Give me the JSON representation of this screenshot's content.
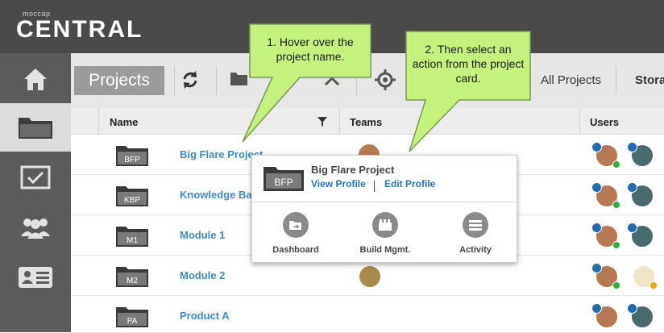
{
  "app": {
    "logo_small": "moccap",
    "logo_big": "CENTRAL"
  },
  "sidebar": {
    "items": [
      {
        "name": "home"
      },
      {
        "name": "projects"
      },
      {
        "name": "tasks"
      },
      {
        "name": "teams"
      },
      {
        "name": "users"
      }
    ]
  },
  "toolbar": {
    "projects_tab": "Projects",
    "filter_label": "All Projects",
    "storage_label": "Stora"
  },
  "table": {
    "headers": {
      "name": "Name",
      "teams": "Teams",
      "users": "Users"
    },
    "rows": [
      {
        "code": "BFP",
        "name": "Big Flare Project"
      },
      {
        "code": "KBP",
        "name": "Knowledge Ba"
      },
      {
        "code": "M1",
        "name": "Module 1"
      },
      {
        "code": "M2",
        "name": "Module 2"
      },
      {
        "code": "PA",
        "name": "Product A"
      }
    ]
  },
  "card": {
    "code": "BFP",
    "title": "Big Flare Project",
    "view_profile": "View Profile",
    "edit_profile": "Edit Profile",
    "actions": [
      {
        "label": "Dashboard",
        "icon": "dashboard-icon"
      },
      {
        "label": "Build Mgmt.",
        "icon": "build-icon"
      },
      {
        "label": "Activity",
        "icon": "activity-icon"
      }
    ]
  },
  "callouts": {
    "one": "1. Hover over the project name.",
    "two": "2. Then select an action from the project card."
  },
  "colors": {
    "callout": "#c5f27e",
    "link": "#3b8bc4",
    "sidebar": "#5b5b5b",
    "topbar": "#4a4a4a"
  }
}
